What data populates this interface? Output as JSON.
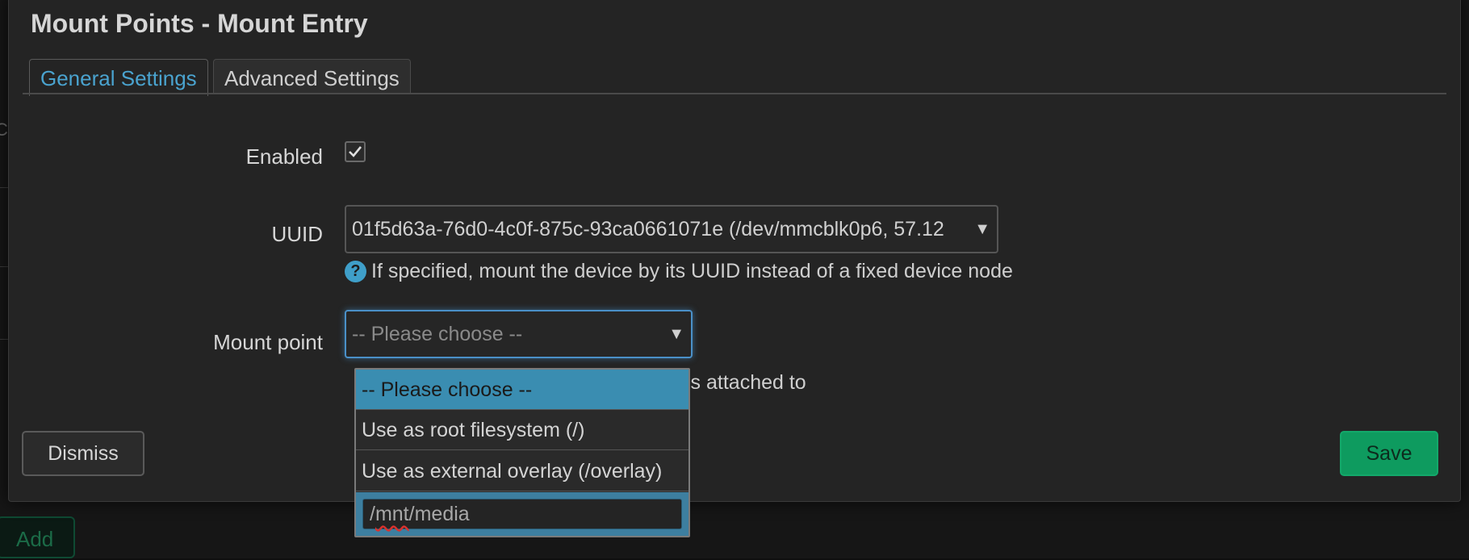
{
  "background": {
    "add_label": "Add",
    "colors": {
      "page": "#161616",
      "add_border": "#0f4a33"
    }
  },
  "modal": {
    "title": "Mount Points - Mount Entry",
    "tabs": [
      {
        "label": "General Settings",
        "active": true
      },
      {
        "label": "Advanced Settings",
        "active": false
      }
    ],
    "fields": {
      "enabled": {
        "label": "Enabled",
        "checked": true
      },
      "uuid": {
        "label": "UUID",
        "value": "01f5d63a-76d0-4c0f-875c-93ca0661071e (/dev/mmcblk0p6, 57.12",
        "help": "If specified, mount the device by its UUID instead of a fixed device node"
      },
      "mount_point": {
        "label": "Mount point",
        "value": "-- Please choose --",
        "help_tail": "is attached to"
      }
    },
    "dismiss_label": "Dismiss",
    "save_label": "Save"
  },
  "dropdown": {
    "options": [
      {
        "label": "-- Please choose --",
        "selected": true
      },
      {
        "label": "Use as root filesystem (/)",
        "selected": false
      },
      {
        "label": "Use as external overlay (/overlay)",
        "selected": false
      }
    ],
    "custom_value": "/mnt/media"
  },
  "colors": {
    "accent": "#4aa3cf",
    "save": "#0e9b5f",
    "highlight": "#3a8db1",
    "focus_border": "#4a90c8"
  }
}
